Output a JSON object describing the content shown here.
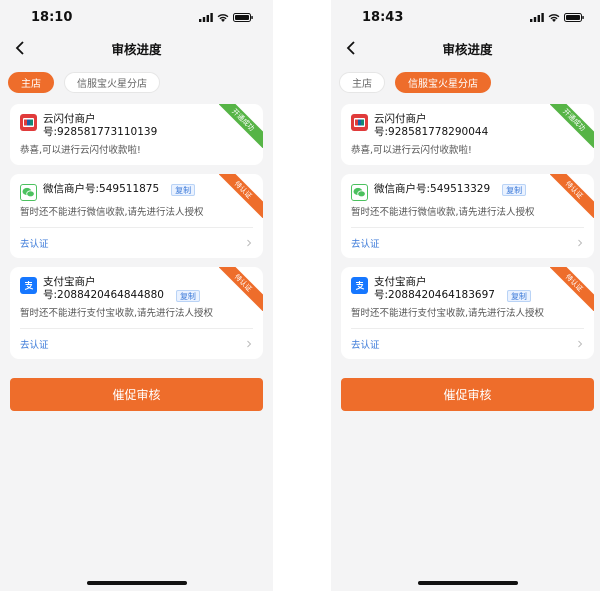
{
  "screens": [
    {
      "status_time": "18:10",
      "nav_title": "审核进度",
      "tabs": [
        {
          "label": "主店",
          "active": true
        },
        {
          "label": "信服宝火星分店",
          "active": false
        }
      ],
      "cards": [
        {
          "merchant_line1": "云闪付商户",
          "merchant_line2": "号:928581773110139",
          "badge": "开通成功",
          "badge_color": "#56b446",
          "desc": "恭喜,可以进行云闪付收款啦!"
        },
        {
          "merchant_line1": "微信商户号:549511875",
          "copy_label": "复制",
          "badge": "待认证",
          "badge_color": "#ee6d2b",
          "desc": "暂时还不能进行微信收款,请先进行法人授权",
          "action": "去认证"
        },
        {
          "merchant_line1": "支付宝商户",
          "merchant_line2": "号:2088420464844880",
          "copy_label": "复制",
          "badge": "待认证",
          "badge_color": "#ee6d2b",
          "desc": "暂时还不能进行支付宝收款,请先进行法人授权",
          "action": "去认证"
        }
      ],
      "cta_label": "催促审核"
    },
    {
      "status_time": "18:43",
      "nav_title": "审核进度",
      "tabs": [
        {
          "label": "主店",
          "active": false
        },
        {
          "label": "信服宝火星分店",
          "active": true
        }
      ],
      "cards": [
        {
          "merchant_line1": "云闪付商户",
          "merchant_line2": "号:928581778290044",
          "badge": "开通成功",
          "badge_color": "#56b446",
          "desc": "恭喜,可以进行云闪付收款啦!"
        },
        {
          "merchant_line1": "微信商户号:549513329",
          "copy_label": "复制",
          "badge": "待认证",
          "badge_color": "#ee6d2b",
          "desc": "暂时还不能进行微信收款,请先进行法人授权",
          "action": "去认证"
        },
        {
          "merchant_line1": "支付宝商户",
          "merchant_line2": "号:2088420464183697",
          "copy_label": "复制",
          "badge": "待认证",
          "badge_color": "#ee6d2b",
          "desc": "暂时还不能进行支付宝收款,请先进行法人授权",
          "action": "去认证"
        }
      ],
      "cta_label": "催促审核"
    }
  ],
  "icons": [
    "back-arrow-icon",
    "signal-icon",
    "wifi-icon",
    "battery-icon",
    "unionpay-logo-icon",
    "wechat-logo-icon",
    "alipay-logo-icon",
    "chevron-right-icon"
  ]
}
